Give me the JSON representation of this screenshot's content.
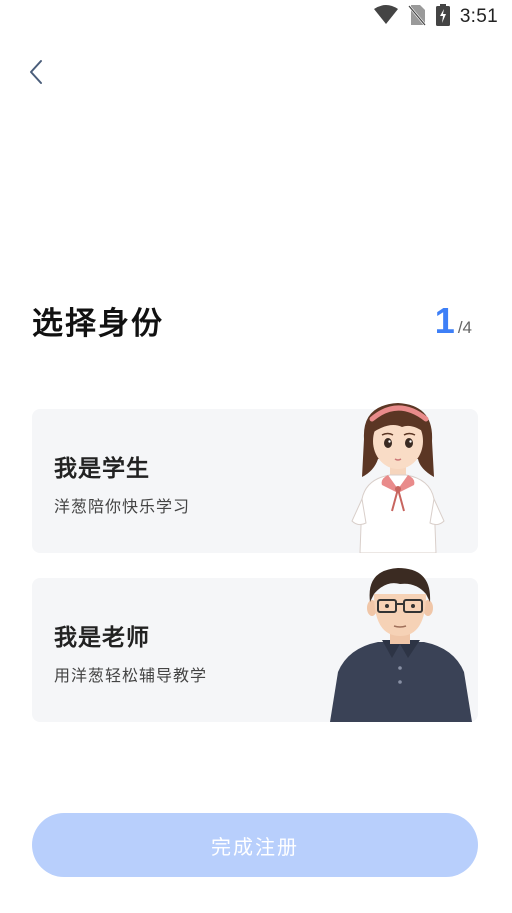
{
  "status_bar": {
    "time": "3:51",
    "icons": [
      "wifi-icon",
      "no-sim-icon",
      "battery-charging-icon"
    ]
  },
  "header": {
    "back_icon": "chevron-left-icon"
  },
  "page": {
    "title": "选择身份",
    "step_current": "1",
    "step_total": "/4"
  },
  "roles": [
    {
      "title": "我是学生",
      "subtitle": "洋葱陪你快乐学习",
      "illustration": "student-girl"
    },
    {
      "title": "我是老师",
      "subtitle": "用洋葱轻松辅导教学",
      "illustration": "teacher-man"
    }
  ],
  "submit": {
    "label": "完成注册",
    "enabled": false
  },
  "colors": {
    "accent": "#3d7ff7",
    "button_disabled": "#b8cffc",
    "card_bg": "#f5f6f8"
  }
}
